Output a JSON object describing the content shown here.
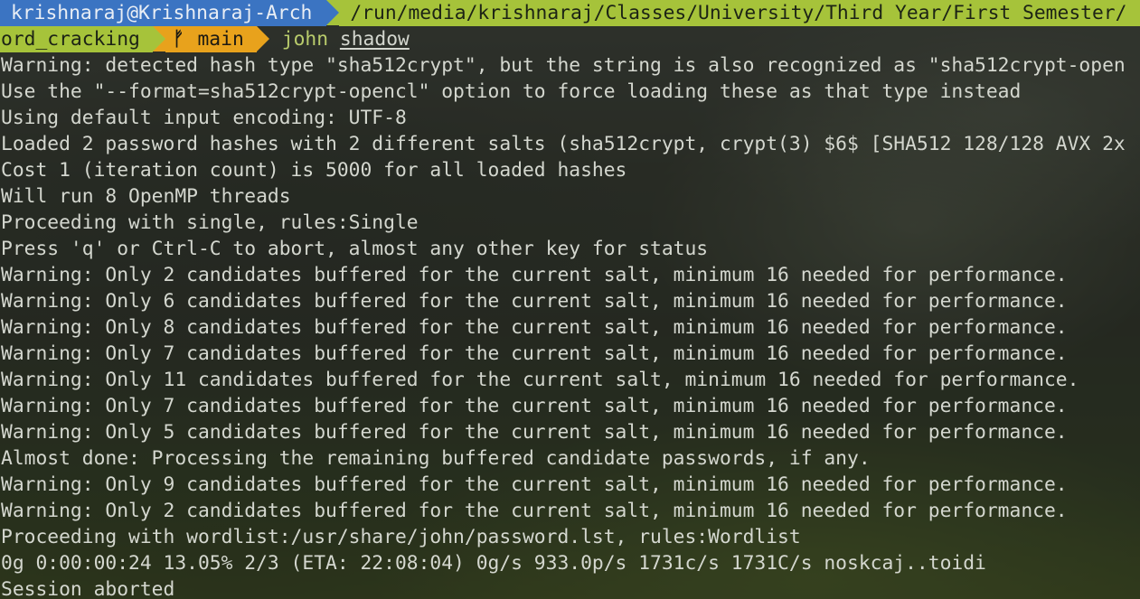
{
  "prompt": {
    "user_host": "krishnaraj@Krishnaraj-Arch",
    "path": "/run/media/krishnaraj/Classes/University/Third Year/First Semester/",
    "dir_continued": "ord_cracking",
    "branch_icon": "ᚠ",
    "branch": "main",
    "command": "john",
    "command_arg": "shadow",
    "colors": {
      "user_bg": "#3b74c2",
      "path_bg": "#a6c33a",
      "branch_bg": "#e8a21c"
    }
  },
  "output": [
    "Warning: detected hash type \"sha512crypt\", but the string is also recognized as \"sha512crypt-open",
    "Use the \"--format=sha512crypt-opencl\" option to force loading these as that type instead",
    "Using default input encoding: UTF-8",
    "Loaded 2 password hashes with 2 different salts (sha512crypt, crypt(3) $6$ [SHA512 128/128 AVX 2x",
    "Cost 1 (iteration count) is 5000 for all loaded hashes",
    "Will run 8 OpenMP threads",
    "Proceeding with single, rules:Single",
    "Press 'q' or Ctrl-C to abort, almost any other key for status",
    "Warning: Only 2 candidates buffered for the current salt, minimum 16 needed for performance.",
    "Warning: Only 6 candidates buffered for the current salt, minimum 16 needed for performance.",
    "Warning: Only 8 candidates buffered for the current salt, minimum 16 needed for performance.",
    "Warning: Only 7 candidates buffered for the current salt, minimum 16 needed for performance.",
    "Warning: Only 11 candidates buffered for the current salt, minimum 16 needed for performance.",
    "Warning: Only 7 candidates buffered for the current salt, minimum 16 needed for performance.",
    "Warning: Only 5 candidates buffered for the current salt, minimum 16 needed for performance.",
    "Almost done: Processing the remaining buffered candidate passwords, if any.",
    "Warning: Only 9 candidates buffered for the current salt, minimum 16 needed for performance.",
    "Warning: Only 2 candidates buffered for the current salt, minimum 16 needed for performance.",
    "Proceeding with wordlist:/usr/share/john/password.lst, rules:Wordlist",
    "0g 0:00:00:24 13.05% 2/3 (ETA: 22:08:04) 0g/s 933.0p/s 1731c/s 1731C/s noskcaj..toidi",
    "Session aborted"
  ]
}
